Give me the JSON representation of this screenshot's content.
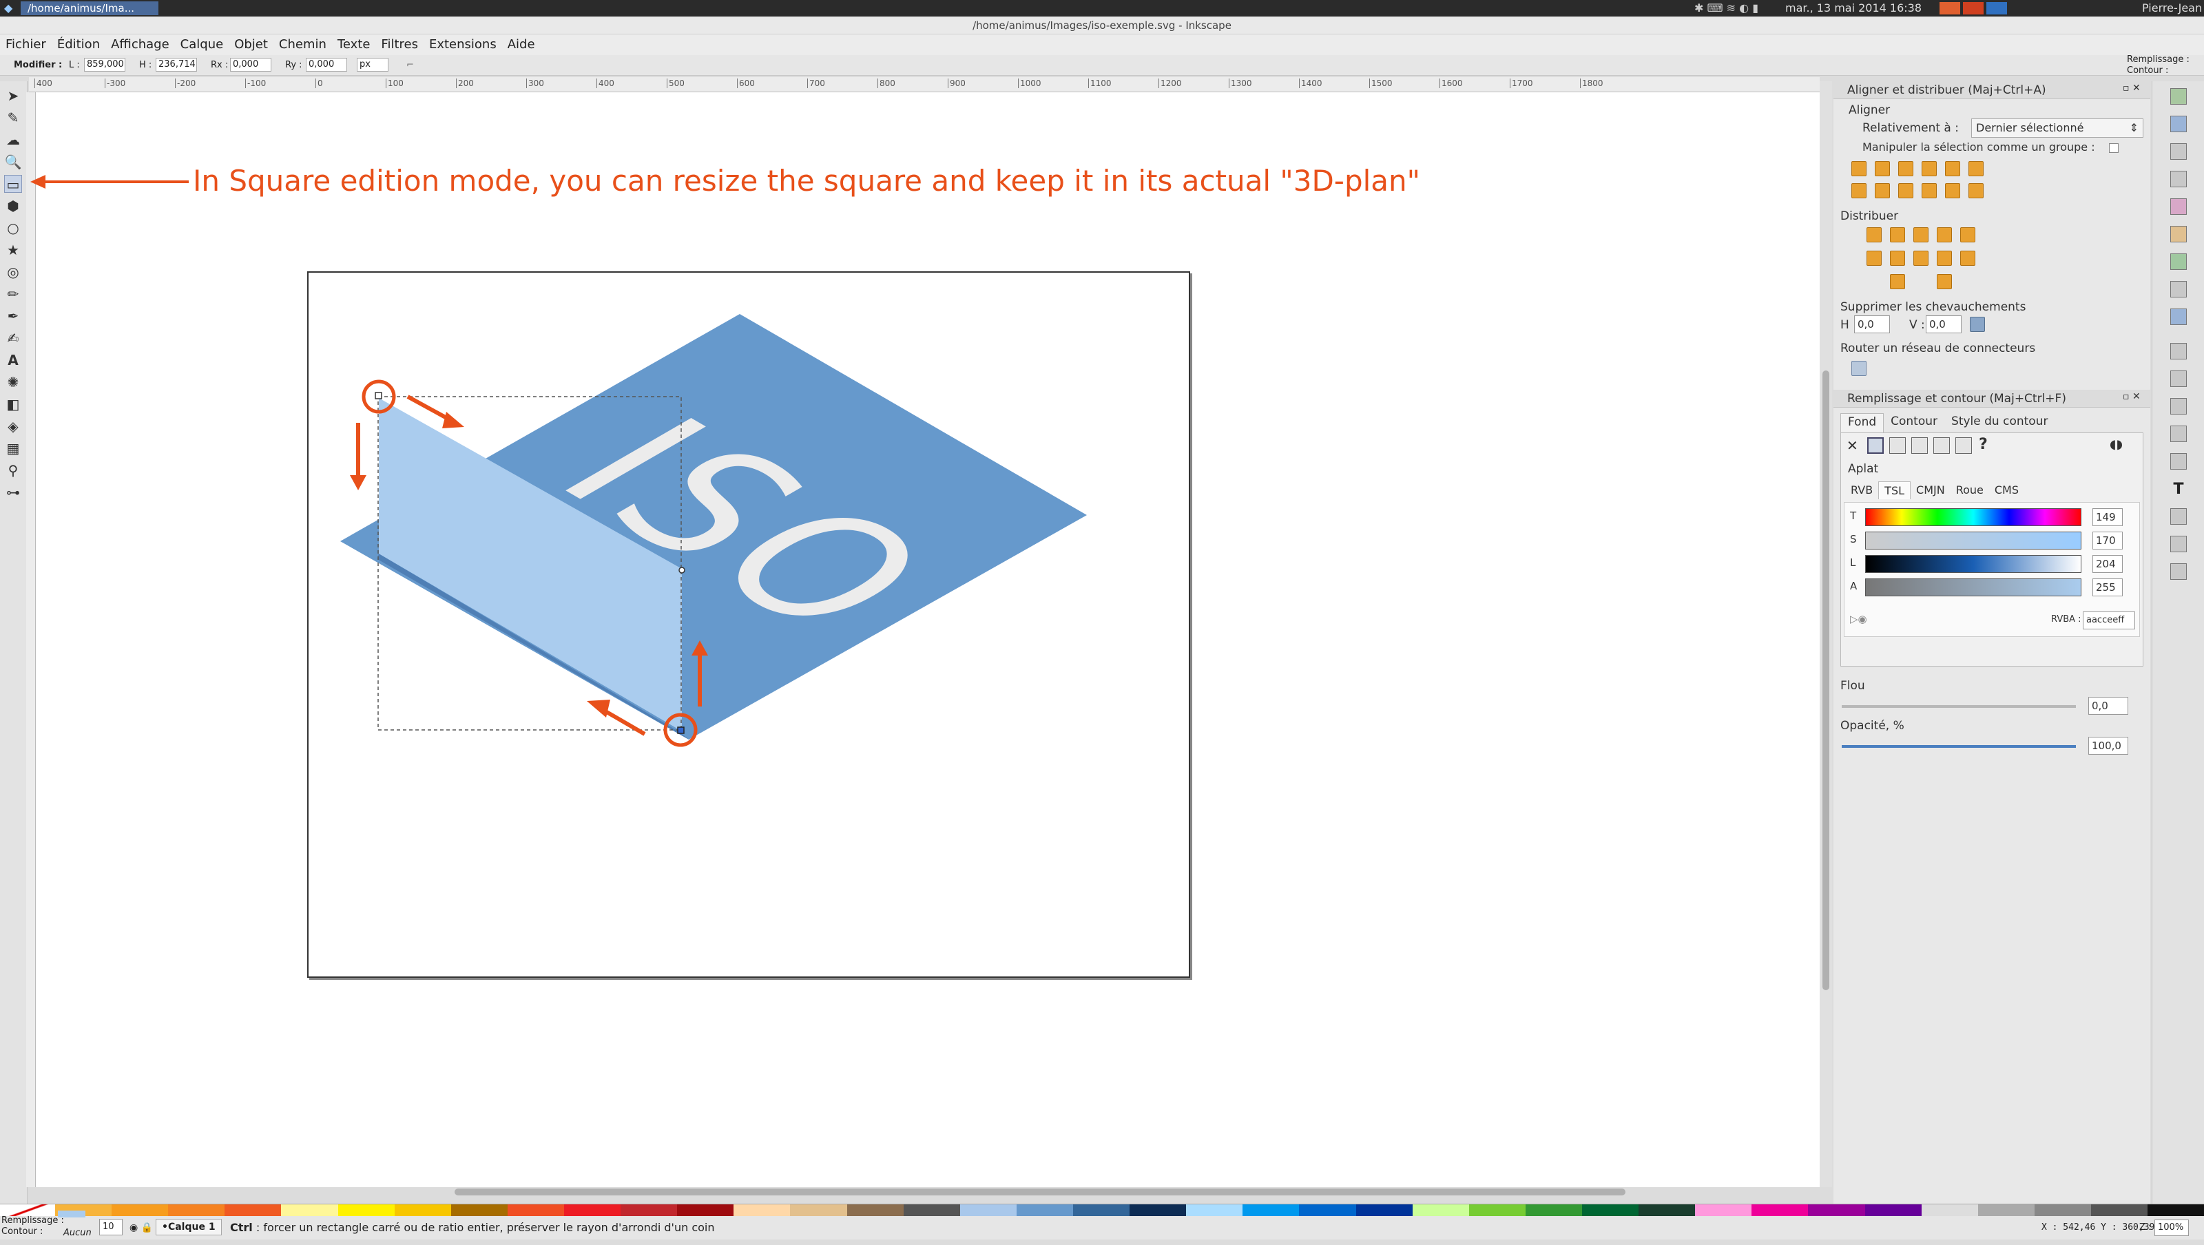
{
  "system_bar": {
    "window_button": "/home/animus/Ima...",
    "datetime": "mar., 13 mai 2014 16:38",
    "user": "Pierre-Jean"
  },
  "title_bar": {
    "title": "/home/animus/Images/iso-exemple.svg - Inkscape"
  },
  "menu": [
    "Fichier",
    "Édition",
    "Affichage",
    "Calque",
    "Objet",
    "Chemin",
    "Texte",
    "Filtres",
    "Extensions",
    "Aide"
  ],
  "controls": {
    "label": "Modifier :",
    "w_label": "L :",
    "w_value": "859,000",
    "h_label": "H :",
    "h_value": "236,714",
    "rx_label": "Rx :",
    "rx_value": "0,000",
    "ry_label": "Ry :",
    "ry_value": "0,000",
    "unit": "px"
  },
  "top_right_indicator": {
    "fill": "Remplissage :",
    "stroke": "Contour :"
  },
  "ruler_ticks": [
    "400",
    "-300",
    "-200",
    "-100",
    "0",
    "100",
    "200",
    "300",
    "400",
    "500",
    "600",
    "700",
    "800",
    "900",
    "1000",
    "1100",
    "1200",
    "1300",
    "1400",
    "1500",
    "1600",
    "1700",
    "1800"
  ],
  "annotation": "In Square edition mode, you can resize the square and keep it in its actual \"3D-plan\"",
  "drawing_text": "ISO",
  "colors": {
    "accent": "#e8501a",
    "iso_blue": "#6699cc",
    "light_face": "#aacceeff",
    "shadow_blue": "#5a8fc6"
  },
  "align_panel": {
    "title": "Aligner et distribuer (Maj+Ctrl+A)",
    "section_align": "Aligner",
    "relative_label": "Relativement à :",
    "relative_value": "Dernier sélectionné",
    "group_label": "Manipuler la sélection comme un groupe :",
    "section_distribute": "Distribuer",
    "section_overlap": "Supprimer les chevauchements",
    "h_label": "H :",
    "h_value": "0,0",
    "v_label": "V :",
    "v_value": "0,0",
    "section_connectors": "Router un réseau de connecteurs"
  },
  "fill_panel": {
    "title": "Remplissage et contour (Maj+Ctrl+F)",
    "tabs": [
      "Fond",
      "Contour",
      "Style du contour"
    ],
    "flat_label": "Aplat",
    "modes": [
      "RVB",
      "TSL",
      "CMJN",
      "Roue",
      "CMS"
    ],
    "sliders": [
      {
        "label": "T",
        "value": "149"
      },
      {
        "label": "S",
        "value": "170"
      },
      {
        "label": "L",
        "value": "204"
      },
      {
        "label": "A",
        "value": "255"
      }
    ],
    "rgba_label": "RVBA :",
    "rgba_value": "aacceeff",
    "blur_label": "Flou",
    "blur_value": "0,0",
    "opacity_label": "Opacité, %",
    "opacity_value": "100,0"
  },
  "palette_colors": [
    "#f7b43b",
    "#f79d1e",
    "#f58220",
    "#f05a22",
    "#fff799",
    "#fff200",
    "#f7c600",
    "#a66c00",
    "#f04e23",
    "#ed1c24",
    "#c1272d",
    "#9e0b0f",
    "#ffd8a8",
    "#e3c08d",
    "#8b6d4e",
    "#555555",
    "#a9c8eb",
    "#6699cc",
    "#336699",
    "#0d2c54",
    "#aaddff",
    "#0099ee",
    "#0066cc",
    "#003399",
    "#ccff99",
    "#77cc33",
    "#339933",
    "#006633",
    "#1a3d2e",
    "#ff99dd",
    "#ee0099",
    "#990099",
    "#660099",
    "#dddddd",
    "#aaaaaa",
    "#888888",
    "#555555",
    "#111111"
  ],
  "status": {
    "fill_label": "Remplissage :",
    "stroke_label": "Contour :",
    "stroke_value": "Aucun",
    "opacity_value": "10",
    "layer": "•Calque 1",
    "message_key": "Ctrl",
    "message": " : forcer un rectangle carré ou de ratio entier, préserver le rayon d'arrondi d'un coin",
    "coords": "X : 542,46  Y : 360,39",
    "zoom_label": "Z :",
    "zoom": "100%"
  }
}
